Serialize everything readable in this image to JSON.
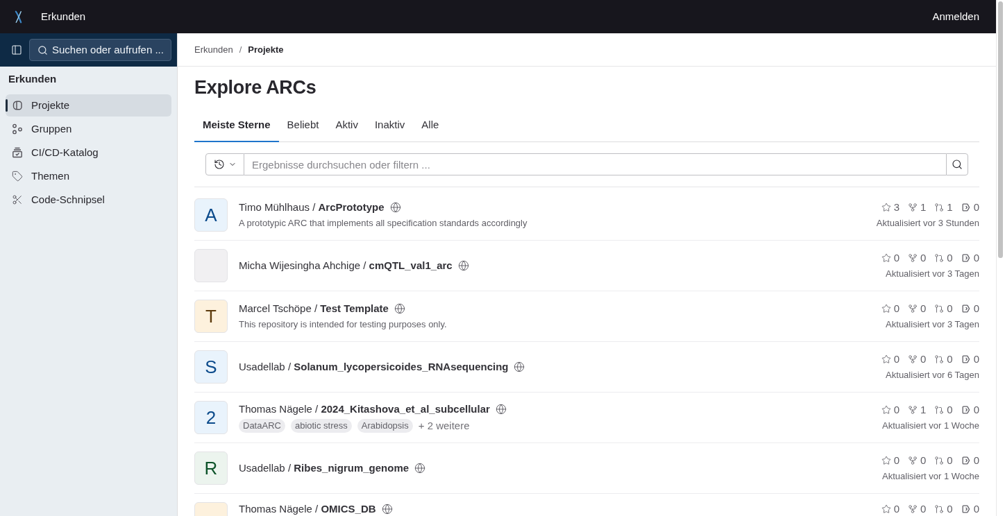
{
  "top_bar": {
    "title": "Erkunden",
    "action": "Anmelden"
  },
  "sidebar": {
    "search_label": "Suchen oder aufrufen ...",
    "heading": "Erkunden",
    "items": [
      {
        "label": "Projekte",
        "selected": true
      },
      {
        "label": "Gruppen",
        "selected": false
      },
      {
        "label": "CI/CD-Katalog",
        "selected": false
      },
      {
        "label": "Themen",
        "selected": false
      },
      {
        "label": "Code-Schnipsel",
        "selected": false
      }
    ]
  },
  "breadcrumb": {
    "separator": "/",
    "items": [
      {
        "label": "Erkunden",
        "current": false
      },
      {
        "label": "Projekte",
        "current": true
      }
    ]
  },
  "page_title": "Explore ARCs",
  "tabs": [
    {
      "label": "Meiste Sterne",
      "selected": true
    },
    {
      "label": "Beliebt",
      "selected": false
    },
    {
      "label": "Aktiv",
      "selected": false
    },
    {
      "label": "Inaktiv",
      "selected": false
    },
    {
      "label": "Alle",
      "selected": false
    }
  ],
  "filter": {
    "placeholder": "Ergebnisse durchsuchen oder filtern ..."
  },
  "projects": [
    {
      "avatar": {
        "kind": "letter",
        "letter": "A",
        "color": "#e9f3fc"
      },
      "title": "Timo Mühlhaus / **ArcPrototype**",
      "public": true,
      "description": "A prototypic ARC that implements all specification standards accordingly",
      "star_count": "3",
      "forks": "1",
      "merge_requests": "1",
      "issues": "0",
      "updated": "Aktualisiert vor 3 Stunden"
    },
    {
      "avatar": {
        "kind": "image"
      },
      "title": "Micha Wijesingha Ahchige / **cmQTL_val1_arc**",
      "public": true,
      "star_count": "0",
      "forks": "0",
      "merge_requests": "0",
      "issues": "0",
      "updated": "Aktualisiert vor 3 Tagen"
    },
    {
      "avatar": {
        "kind": "letter",
        "letter": "T",
        "color": "#fdf1dd"
      },
      "title": "Marcel Tschöpe / **Test Template**",
      "public": true,
      "description": "This repository is intended for testing purposes only.",
      "star_count": "0",
      "forks": "0",
      "merge_requests": "0",
      "issues": "0",
      "updated": "Aktualisiert vor 3 Tagen"
    },
    {
      "avatar": {
        "kind": "letter",
        "letter": "S",
        "color": "#e9f3fc"
      },
      "title": "Usadellab / **Solanum_lycopersicoides_RNAsequencing**",
      "public": true,
      "star_count": "0",
      "forks": "0",
      "merge_requests": "0",
      "issues": "0",
      "updated": "Aktualisiert vor 6 Tagen"
    },
    {
      "avatar": {
        "kind": "letter",
        "letter": "2",
        "color": "#e9f3fc"
      },
      "title": "Thomas Nägele / **2024_Kitashova_et_al_subcellular**",
      "public": true,
      "tags": [
        "DataARC",
        "abiotic stress",
        "Arabidopsis"
      ],
      "more_tags": "+ 2 weitere",
      "star_count": "0",
      "forks": "1",
      "merge_requests": "0",
      "issues": "0",
      "updated": "Aktualisiert vor 1 Woche"
    },
    {
      "avatar": {
        "kind": "letter",
        "letter": "R",
        "color": "#ecf4ee"
      },
      "title": "Usadellab / **Ribes_nigrum_genome**",
      "public": true,
      "star_count": "0",
      "forks": "0",
      "merge_requests": "0",
      "issues": "0",
      "updated": "Aktualisiert vor 1 Woche"
    },
    {
      "avatar": {
        "kind": "letter",
        "color": "#fdf1dd"
      },
      "title": "Thomas Nägele / **OMICS_DB**",
      "public": true,
      "star_count": "0",
      "forks": "0",
      "merge_requests": "0",
      "issues": "0"
    }
  ]
}
